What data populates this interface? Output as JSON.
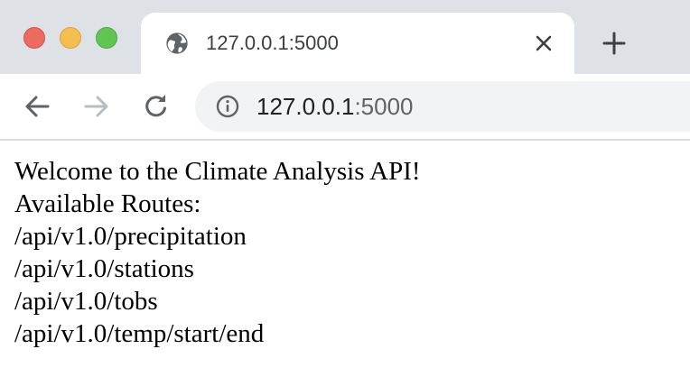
{
  "browser": {
    "tab": {
      "title": "127.0.0.1:5000",
      "favicon": "globe-icon"
    },
    "address_bar": {
      "host": "127.0.0.1",
      "port": ":5000"
    },
    "icons": {
      "close_tab": "close-icon",
      "new_tab": "plus-icon",
      "back": "arrow-left-icon",
      "forward": "arrow-right-icon",
      "reload": "reload-icon",
      "site_info": "info-icon"
    },
    "colors": {
      "tabstrip_bg": "#dee1e6",
      "omnibox_bg": "#f1f3f4",
      "close_red": "#ed6a5e",
      "minimize_yellow": "#f5bf4f",
      "zoom_green": "#61c554"
    }
  },
  "page": {
    "heading": "Welcome to the Climate Analysis API!",
    "subheading": "Available Routes:",
    "routes": [
      "/api/v1.0/precipitation",
      "/api/v1.0/stations",
      "/api/v1.0/tobs",
      "/api/v1.0/temp/start/end"
    ]
  }
}
